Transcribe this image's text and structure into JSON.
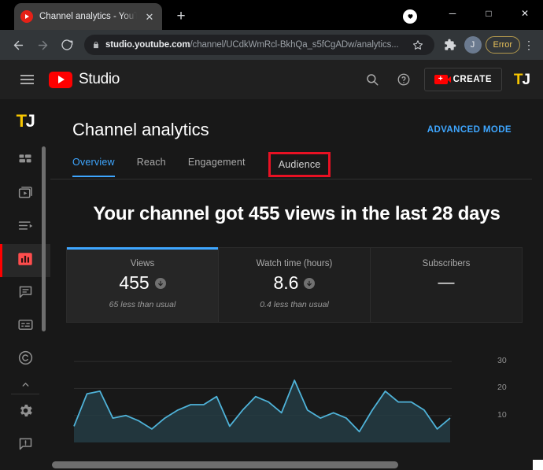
{
  "browser": {
    "tab": {
      "title": "Channel analytics - YouTube Stud",
      "favicon": "youtube-icon",
      "close_label": "✕"
    },
    "newtab_label": "+",
    "window_controls": {
      "heart": "♥",
      "minimize": "─",
      "maximize": "□",
      "close": "✕"
    },
    "nav": {
      "back": "←",
      "forward": "→",
      "reload": "⟳"
    },
    "omnibox": {
      "lock": "lock-icon",
      "url_bold": "studio.youtube.com",
      "url_rest": "/channel/UCdkWmRcl-BkhQa_s5fCgADw/analytics...",
      "star": "☆"
    },
    "extensions_icon": "puzzle-icon",
    "profile_initial": "J",
    "error_pill": "Error",
    "menu": "⋮"
  },
  "studio": {
    "header": {
      "menu_icon": "hamburger-icon",
      "brand": "Studio",
      "search_icon": "search-icon",
      "help_icon": "help-icon",
      "create_label": "CREATE",
      "create_icon": "video-plus-icon",
      "avatar_t": "T",
      "avatar_j": "J"
    },
    "rail": {
      "avatar_t": "T",
      "avatar_j": "J",
      "items": [
        {
          "name": "dashboard",
          "icon": "dashboard-grid-icon",
          "active": false
        },
        {
          "name": "content",
          "icon": "video-library-icon",
          "active": false
        },
        {
          "name": "playlists",
          "icon": "playlist-icon",
          "active": false
        },
        {
          "name": "analytics",
          "icon": "analytics-bars-icon",
          "active": true
        },
        {
          "name": "comments",
          "icon": "comment-icon",
          "active": false
        },
        {
          "name": "subtitles",
          "icon": "subtitles-icon",
          "active": false
        },
        {
          "name": "copyright",
          "icon": "copyright-icon",
          "active": false
        }
      ],
      "collapse_icon": "chevron-up-icon",
      "settings_icon": "gear-icon",
      "feedback_icon": "feedback-icon"
    },
    "page": {
      "title": "Channel analytics",
      "advanced_mode": "ADVANCED MODE",
      "tabs": [
        {
          "label": "Overview",
          "active": true,
          "boxed": false
        },
        {
          "label": "Reach",
          "active": false,
          "boxed": false
        },
        {
          "label": "Engagement",
          "active": false,
          "boxed": false
        },
        {
          "label": "Audience",
          "active": false,
          "boxed": true
        }
      ],
      "headline": "Your channel got 455 views in the last 28 days",
      "metric_cards": [
        {
          "label": "Views",
          "value": "455",
          "trend_icon": "arrow-down-icon",
          "sub": "65 less than usual",
          "selected": true
        },
        {
          "label": "Watch time (hours)",
          "value": "8.6",
          "trend_icon": "arrow-down-icon",
          "sub": "0.4 less than usual",
          "selected": false
        },
        {
          "label": "Subscribers",
          "value": "—",
          "trend_icon": "",
          "sub": "",
          "selected": false
        }
      ]
    },
    "colors": {
      "accent_blue": "#3ea6ff",
      "youtube_red": "#ff0000",
      "annotation_red": "#e81123",
      "chart_line": "#4fb3d9",
      "page_bg": "#181818",
      "card_bg": "#1f1f1f"
    }
  },
  "chart_data": {
    "type": "area",
    "title": "",
    "xlabel": "",
    "ylabel": "",
    "ylim": [
      0,
      35
    ],
    "yticks": [
      10,
      20,
      30
    ],
    "grid": true,
    "legend": "none",
    "series": [
      {
        "name": "Views",
        "values": [
          6,
          18,
          19,
          9,
          10,
          8,
          5,
          9,
          12,
          14,
          14,
          17,
          6,
          12,
          17,
          15,
          11,
          23,
          12,
          9,
          11,
          9,
          4,
          12,
          19,
          15,
          15,
          12,
          5,
          9
        ]
      }
    ],
    "x": [
      1,
      2,
      3,
      4,
      5,
      6,
      7,
      8,
      9,
      10,
      11,
      12,
      13,
      14,
      15,
      16,
      17,
      18,
      19,
      20,
      21,
      22,
      23,
      24,
      25,
      26,
      27,
      28,
      29,
      30
    ]
  }
}
